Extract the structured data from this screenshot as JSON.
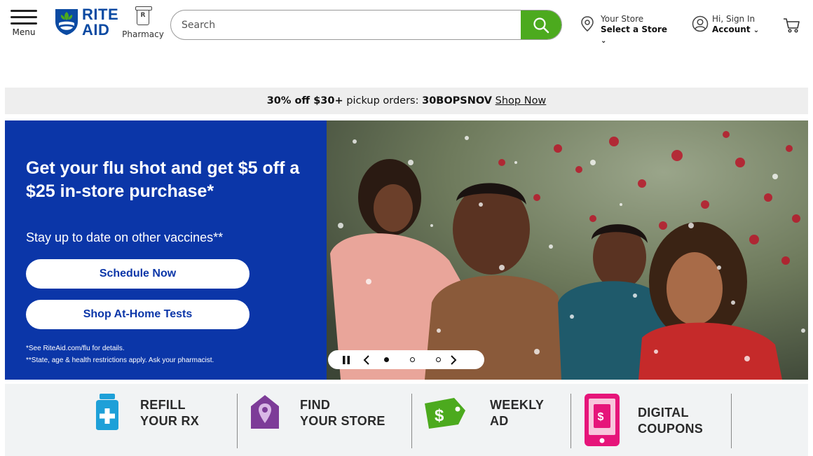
{
  "header": {
    "menu_label": "Menu",
    "logo_line1": "RITE",
    "logo_line2": "AID",
    "pharmacy_label": "Pharmacy",
    "search_placeholder": "Search",
    "store_line1": "Your Store",
    "store_line2": "Select a Store",
    "account_line1": "Hi, Sign In",
    "account_line2": "Account"
  },
  "promo": {
    "bold_prefix": "30% off $30+",
    "text": " pickup orders: ",
    "code": "30BOPSNOV",
    "link": "Shop Now"
  },
  "hero": {
    "title": "Get your flu shot and get $5 off a $25 in-store purchase*",
    "subtitle": "Stay up to date on other vaccines**",
    "button1": "Schedule Now",
    "button2": "Shop At-Home Tests",
    "disclaimer1": "*See RiteAid.com/flu for details.",
    "disclaimer2": "**State, age & health restrictions apply. Ask your pharmacist."
  },
  "carousel": {
    "slides": 3,
    "active": 1
  },
  "quick_links": [
    {
      "line1": "REFILL",
      "line2": "YOUR RX",
      "icon": "refill-rx-icon",
      "color": "#1ea0d8"
    },
    {
      "line1": "FIND",
      "line2": "YOUR STORE",
      "icon": "find-store-icon",
      "color": "#7d3c98"
    },
    {
      "line1": "WEEKLY",
      "line2": "AD",
      "icon": "weekly-ad-icon",
      "color": "#4caa1e"
    },
    {
      "line1": "DIGITAL",
      "line2": "COUPONS",
      "icon": "digital-coupons-icon",
      "color": "#e6157a"
    }
  ],
  "colors": {
    "brand_blue": "#0b36a8",
    "search_green": "#4caa1e",
    "promo_bg": "#eeeeee"
  }
}
